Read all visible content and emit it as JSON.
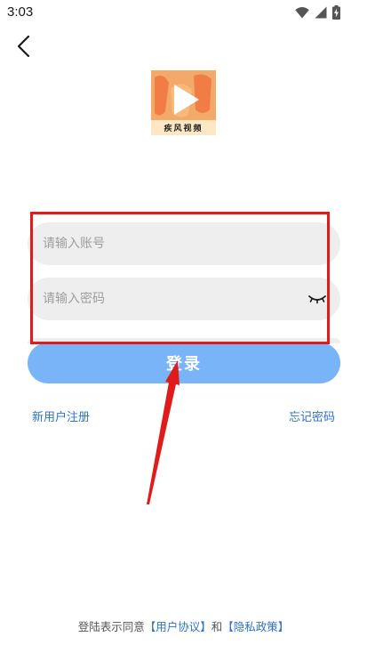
{
  "status_bar": {
    "time": "3:03",
    "icons": [
      "wifi-icon",
      "cellular-signal-icon",
      "battery-charging-icon"
    ]
  },
  "header": {
    "back_icon": "chevron-left-icon"
  },
  "logo": {
    "caption": "疾风视频",
    "icon": "play-icon"
  },
  "form": {
    "account_placeholder": "请输入账号",
    "password_placeholder": "请输入密码",
    "password_toggle_icon": "eye-closed-icon",
    "login_label": "登录"
  },
  "links": {
    "register": "新用户注册",
    "forgot_password": "忘记密码"
  },
  "agreement": {
    "prefix": "登陆表示同意",
    "user_agreement": "【用户协议】",
    "conjunction": "和",
    "privacy_policy": "【隐私政策】"
  },
  "colors": {
    "button": "#79b4f8",
    "link": "#2f72c9",
    "field_bg": "#eeeeee",
    "annotation": "#e01b1b"
  }
}
